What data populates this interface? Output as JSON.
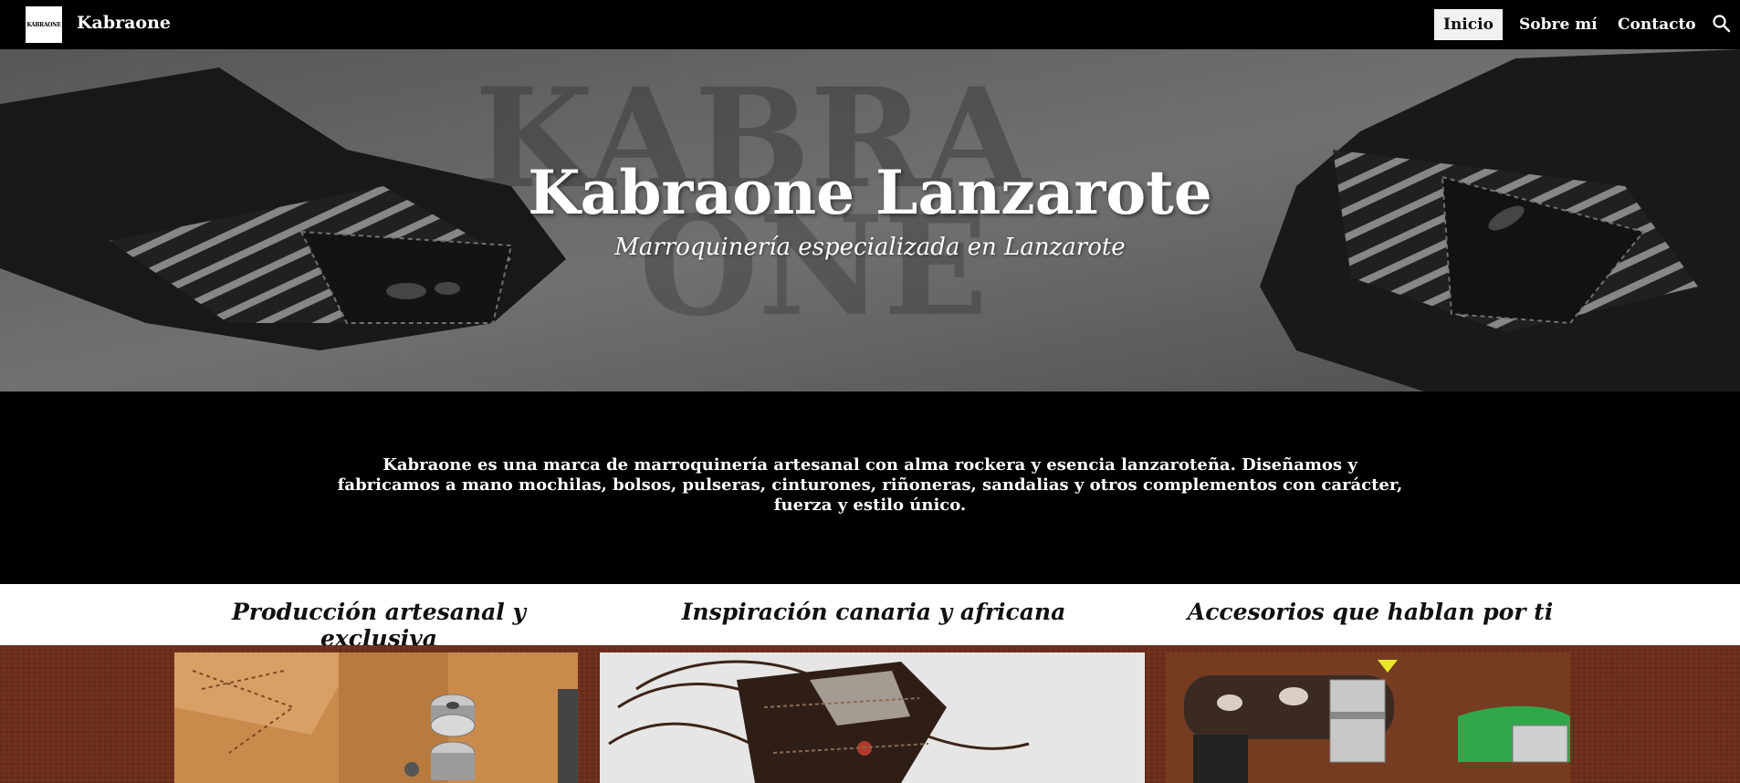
{
  "site": {
    "logo_text": "KABRAONE",
    "name": "Kabraone"
  },
  "nav": {
    "items": [
      {
        "label": "Inicio",
        "active": true
      },
      {
        "label": "Sobre mí",
        "active": false
      },
      {
        "label": "Contacto",
        "active": false
      }
    ],
    "search_icon": "search-icon"
  },
  "hero": {
    "title": "Kabraone Lanzarote",
    "subtitle": "Marroquinería especializada en Lanzarote",
    "background_word_1": "KABRA",
    "background_word_2": "ONE"
  },
  "intro": {
    "text": "Kabraone es una marca de marroquinería artesanal con alma rockera y esencia lanzaroteña. Diseñamos y fabricamos a mano mochilas, bolsos, pulseras, cinturones, riñoneras, sandalias y otros complementos con carácter, fuerza y estilo único."
  },
  "features": [
    {
      "title": "Producción artesanal y exclusiva"
    },
    {
      "title": "Inspiración canaria y africana"
    },
    {
      "title": "Accesorios que hablan por ti"
    }
  ],
  "colors": {
    "nav_bg": "#000000",
    "nav_active_bg": "#f1f1f1",
    "band_bg": "#6b2e1c",
    "accent_yellow": "#e8e62a"
  }
}
